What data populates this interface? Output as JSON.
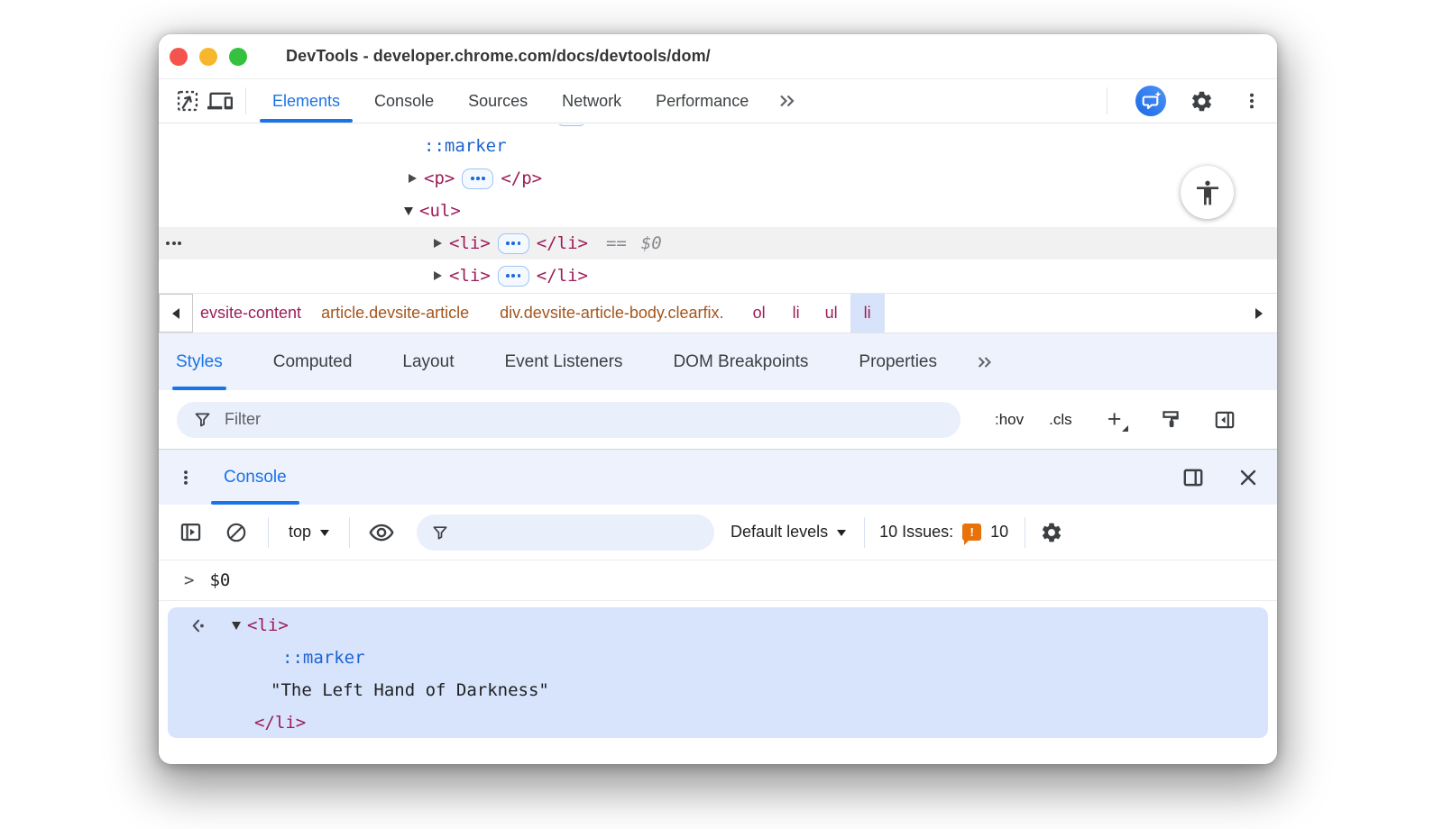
{
  "colors": {
    "accent_blue": "#1a73e8",
    "tag_crimson": "#9c1d59",
    "class_orange": "#a5551b",
    "marker_blue": "#1e63d0",
    "string_dark": "#202124",
    "issues_orange": "#e8710a",
    "selected_row_gray": "#f1f1f1",
    "selection_blue": "#d7e4fb",
    "panel_tint": "#edf2fc",
    "traffic_close": "#f4544d",
    "traffic_minimize": "#f7b72c",
    "traffic_zoom": "#35c13f"
  },
  "titlebar": {
    "title": "DevTools - developer.chrome.com/docs/devtools/dom/"
  },
  "main_tabs": {
    "items": [
      "Elements",
      "Console",
      "Sources",
      "Network",
      "Performance"
    ],
    "active": "Elements",
    "more_label": "»"
  },
  "elements_panel": {
    "rows": {
      "marker": "::marker",
      "p_open": "<p>",
      "p_close": "</p>",
      "ul_open": "<ul>",
      "li_open": "<li>",
      "li_close": "</li>",
      "equals": "==",
      "dollar_ref": "$0"
    }
  },
  "breadcrumb": {
    "items": [
      "evsite-content",
      "article.devsite-article",
      "div.devsite-article-body.clearfix.",
      "ol",
      "li",
      "ul",
      "li"
    ],
    "selected_index": 6
  },
  "styles_panel": {
    "tabs": [
      "Styles",
      "Computed",
      "Layout",
      "Event Listeners",
      "DOM Breakpoints",
      "Properties"
    ],
    "active": "Styles",
    "more_label": "»",
    "filter_placeholder": "Filter",
    "pseudo_toggle": ":hov",
    "class_toggle": ".cls",
    "plus_label": "+"
  },
  "console_drawer": {
    "tab": "Console",
    "toolbar": {
      "context": "top",
      "levels": "Default levels",
      "issues_label": "10 Issues:",
      "issues_badge": "!",
      "issues_count": "10"
    },
    "echo": {
      "prompt": ">",
      "expression": "$0"
    },
    "result": {
      "li_open": "<li>",
      "marker": "::marker",
      "string": "\"The Left Hand of Darkness\"",
      "li_close": "</li>"
    }
  }
}
